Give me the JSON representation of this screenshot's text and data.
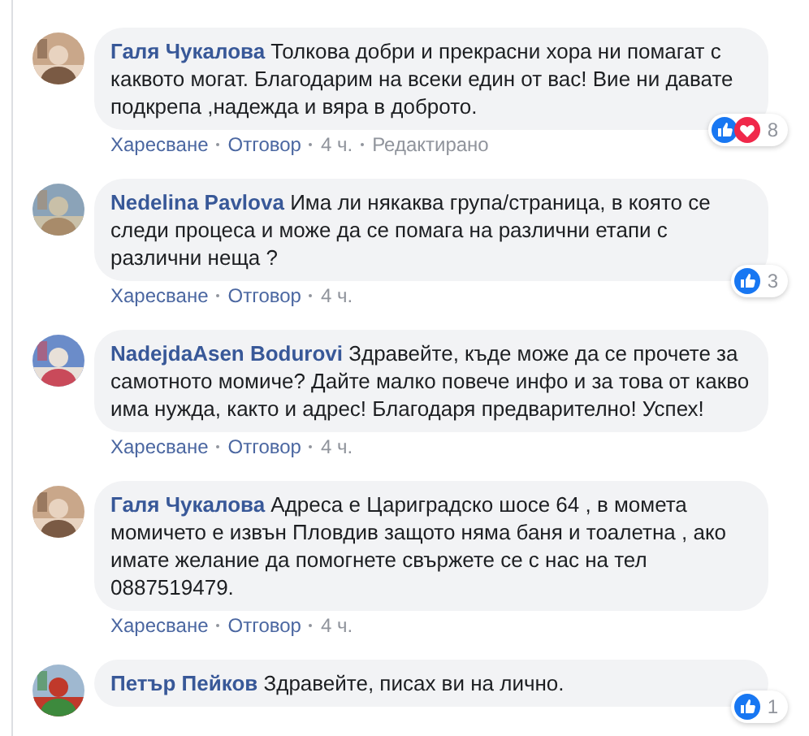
{
  "comments": [
    {
      "text": "**Галя Чукалова** Толкова добри и прекрасни хора ни помагат с каквото могат. Благодарим на всеки един от вас! Вие ни давате подкрепа ,надежда и вяра в доброто.",
      "reactions": [
        {
          "kind": "like"
        },
        {
          "kind": "love"
        }
      ],
      "reaction_count": "8",
      "actions": [
        "Харесване",
        "Отговор",
        "4 ч.",
        "Редактирано"
      ]
    },
    {
      "text": "**Nedelina Pavlova** Има ли някаква група/страница, в която се следи процеса и може да се помага на различни етапи с различни неща ?",
      "reactions": [
        {
          "kind": "like"
        }
      ],
      "reaction_count": "3",
      "actions": [
        "Харесване",
        "Отговор",
        "4 ч."
      ]
    },
    {
      "text": "**NadejdaAsen Bodurovi** Здравейте, къде може да се прочете за самотното момиче? Дайте малко повече инфо и за това от какво има нужда, както и адрес! Благодаря предварително! Успех!",
      "actions": [
        "Харесване",
        "Отговор",
        "4 ч."
      ]
    },
    {
      "text": "**Галя Чукалова** Адреса е Цариградско шосе 64 , в момета момичето е извън Пловдив защото няма баня и тоалетна , ако имате желание да помогнете свържете се с нас на тел 0887519479.",
      "actions": [
        "Харесване",
        "Отговор",
        "4 ч."
      ]
    },
    {
      "text": "**Петър Пейков** Здравейте, писах ви на лично.",
      "reactions": [
        {
          "kind": "like"
        }
      ],
      "reaction_count": "1"
    }
  ]
}
